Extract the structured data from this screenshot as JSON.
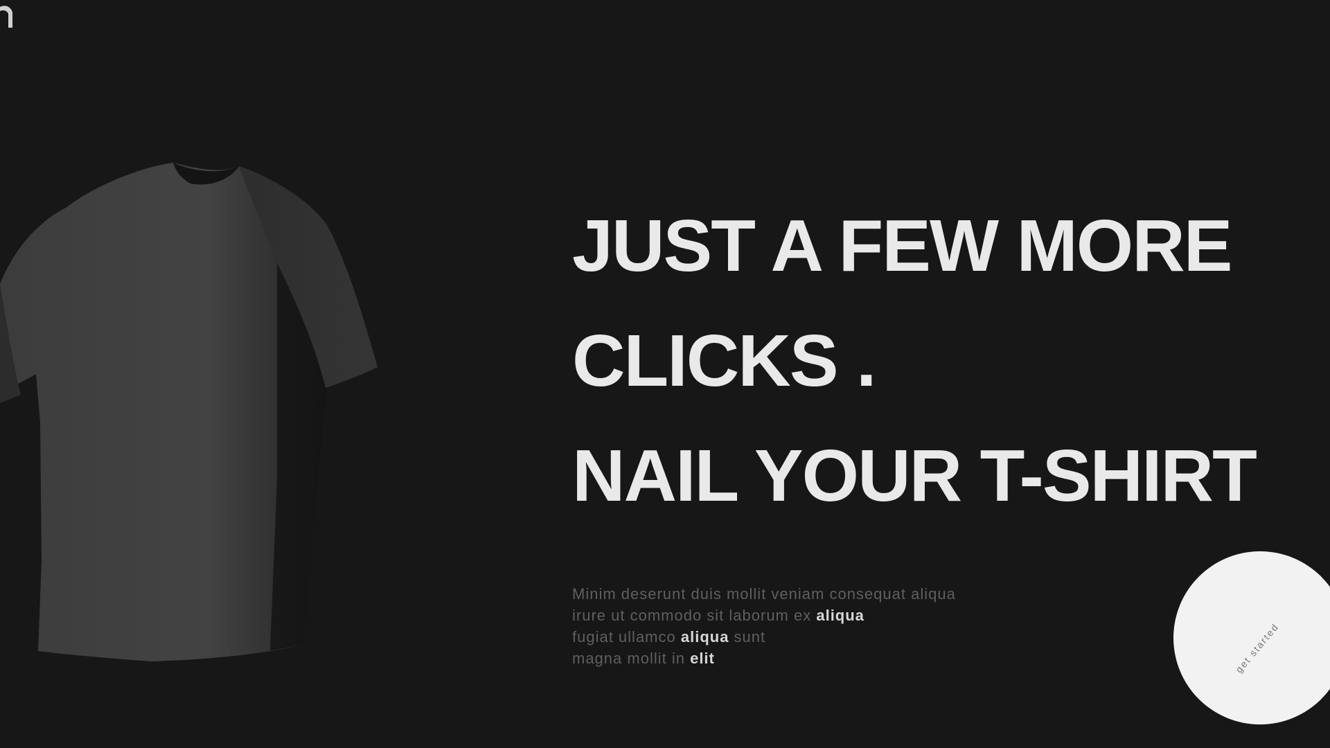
{
  "headline": {
    "line1": "JUST A FEW MORE",
    "line2": "CLICKS .",
    "line3": "NAIL YOUR T-SHIRT"
  },
  "description": {
    "line1": "Minim deserunt duis mollit veniam consequat aliqua",
    "line2_prefix": "irure ut commodo sit laborum ex ",
    "line2_emphasis": "aliqua",
    "line3_prefix": "fugiat ullamco ",
    "line3_emphasis": "aliqua",
    "line3_suffix": " sunt",
    "line4_prefix": "magna mollit in ",
    "line4_emphasis": "elit"
  },
  "cta": {
    "label": "get started"
  },
  "icons": {
    "logo": "brand-logo-icon",
    "product": "t-shirt-preview"
  },
  "colors": {
    "background": "#171717",
    "headline": "#e9e9e9",
    "muted_text": "#5f5f5f",
    "cta_background": "#f2f2f2"
  }
}
